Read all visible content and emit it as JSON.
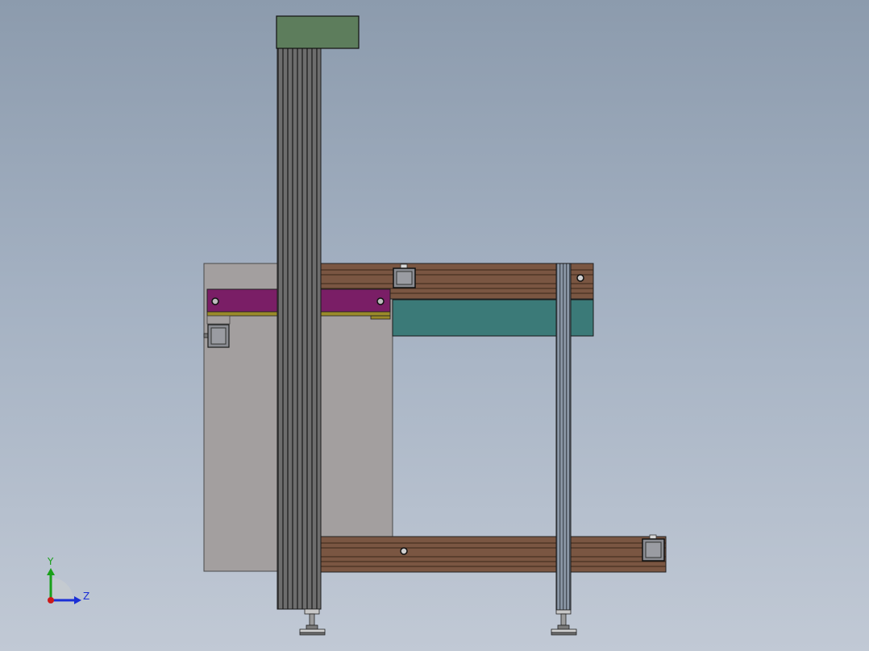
{
  "viewport": {
    "background_top": "#8c9bad",
    "background_bottom": "#c1c9d5"
  },
  "model_colors": {
    "top_cap": "#5d7d5c",
    "column_stripe_dark": "#3f3f3f",
    "column_stripe_light": "#6d6d6d",
    "rail_wood": "#7a5642",
    "rail_groove": "#3b2518",
    "magenta_beam": "#7a1e66",
    "olive_strip": "#9a8a2a",
    "teal_panel": "#3b7a78",
    "backplate": "#a29e9e",
    "thin_column": "#7c8a9a",
    "motor_block": "#8a8c92"
  },
  "triad": {
    "y_label": "Y",
    "z_label": "Z",
    "y_color": "#19a019",
    "z_color": "#1a2fd6",
    "origin_color": "#cc1a1a"
  }
}
